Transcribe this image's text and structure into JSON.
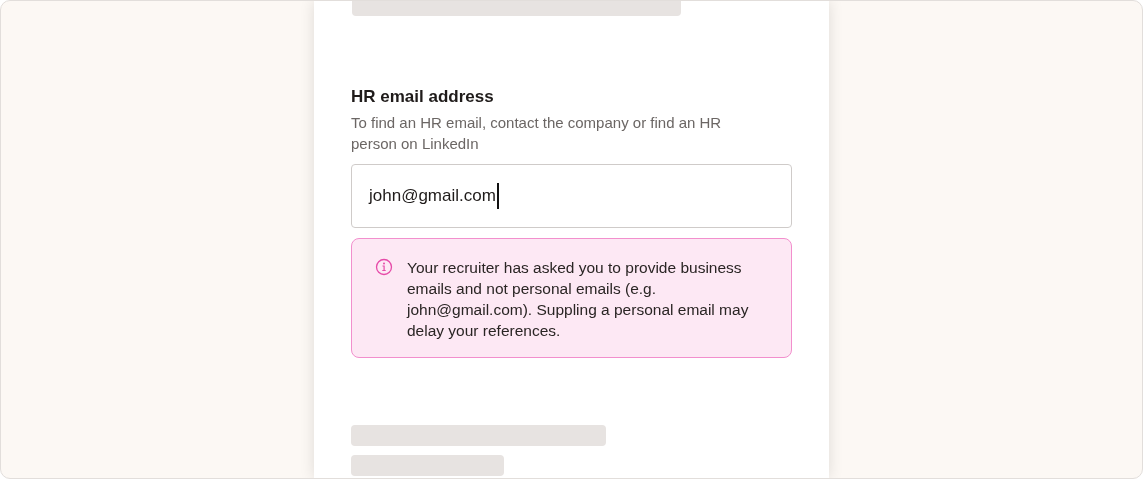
{
  "field": {
    "label": "HR email address",
    "hint": "To find an HR email, contact the company or find an HR person on LinkedIn",
    "value": "john@gmail.com",
    "focused": true
  },
  "alert": {
    "kind": "warning",
    "message": "Your recruiter has asked you to provide business emails and not personal emails (e.g. john@gmail.com). Suppling a personal email may delay your references."
  }
}
